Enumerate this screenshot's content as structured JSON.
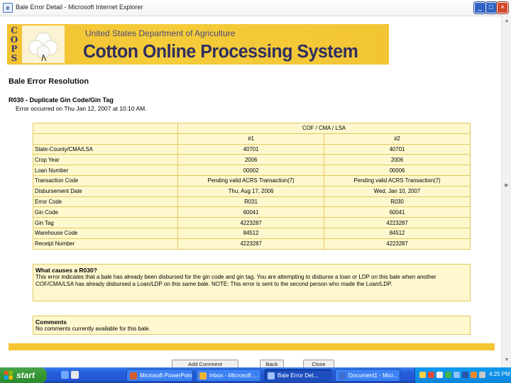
{
  "window": {
    "title": "Bale Error Detail - Microsoft Internet Explorer",
    "min_label": "_",
    "max_label": "□",
    "close_label": "×"
  },
  "banner": {
    "logo_letters": [
      "C",
      "O",
      "P",
      "S"
    ],
    "agency": "United States Department of Agriculture",
    "system_title": "Cotton Online Processing System"
  },
  "page": {
    "heading": "Bale Error Resolution",
    "error_code_title": "R030 - Duplicate Gin Code/Gin Tag",
    "error_occurred": "Error occurred on Thu Jan 12, 2007 at 10:10 AM."
  },
  "table": {
    "group_header": "COF / CMA / LSA",
    "columns": [
      "#1",
      "#2"
    ],
    "rows": [
      {
        "label": "State-County/CMA/LSA",
        "v1": "40701",
        "v2": "40701"
      },
      {
        "label": "Crop Year",
        "v1": "2006",
        "v2": "2006"
      },
      {
        "label": "Loan Number",
        "v1": "00002",
        "v2": "00006"
      },
      {
        "label": "Transaction Code",
        "v1": "Pending valid ACRS Transaction(7)",
        "v2": "Pending valid ACRS Transaction(7)"
      },
      {
        "label": "Disbursement Date",
        "v1": "Thu, Aug 17, 2006",
        "v2": "Wed, Jan 10, 2007"
      },
      {
        "label": "Error Code",
        "v1": "R031",
        "v2": "R030"
      },
      {
        "label": "Gin Code",
        "v1": "60041",
        "v2": "60041"
      },
      {
        "label": "Gin Tag",
        "v1": "4223287",
        "v2": "4223287"
      },
      {
        "label": "Warehouse Code",
        "v1": "84512",
        "v2": "84512"
      },
      {
        "label": "Receipt Number",
        "v1": "4223287",
        "v2": "4223287"
      }
    ]
  },
  "why": {
    "heading": "What causes a R030?",
    "text": "This error indicates that a bale has already been disbursed for the gin code and gin tag. You are attempting to disburse a loan or LDP on this bale when another COF/CMA/LSA has already disbursed a Loan/LDP on this same bale. NOTE: This error is sent to the second person who made the Loan/LDP."
  },
  "comments": {
    "heading": "Comments",
    "text": "No comments currently available for this bale."
  },
  "buttons": {
    "add_comment": "Add Comment",
    "back": "Back",
    "close": "Close"
  },
  "taskbar": {
    "start_label": "start",
    "tasks": [
      "Microsoft PowerPoint - ...",
      "Inbox - Microsoft ...",
      "Bale Error Det...",
      "Document1 - Micr..."
    ],
    "clock": "4:25 PM"
  },
  "colors": {
    "banner_gold": "#f3c534",
    "table_fill": "#fff8cf",
    "table_border": "#e2c95c",
    "taskbar_blue": "#245edb"
  }
}
